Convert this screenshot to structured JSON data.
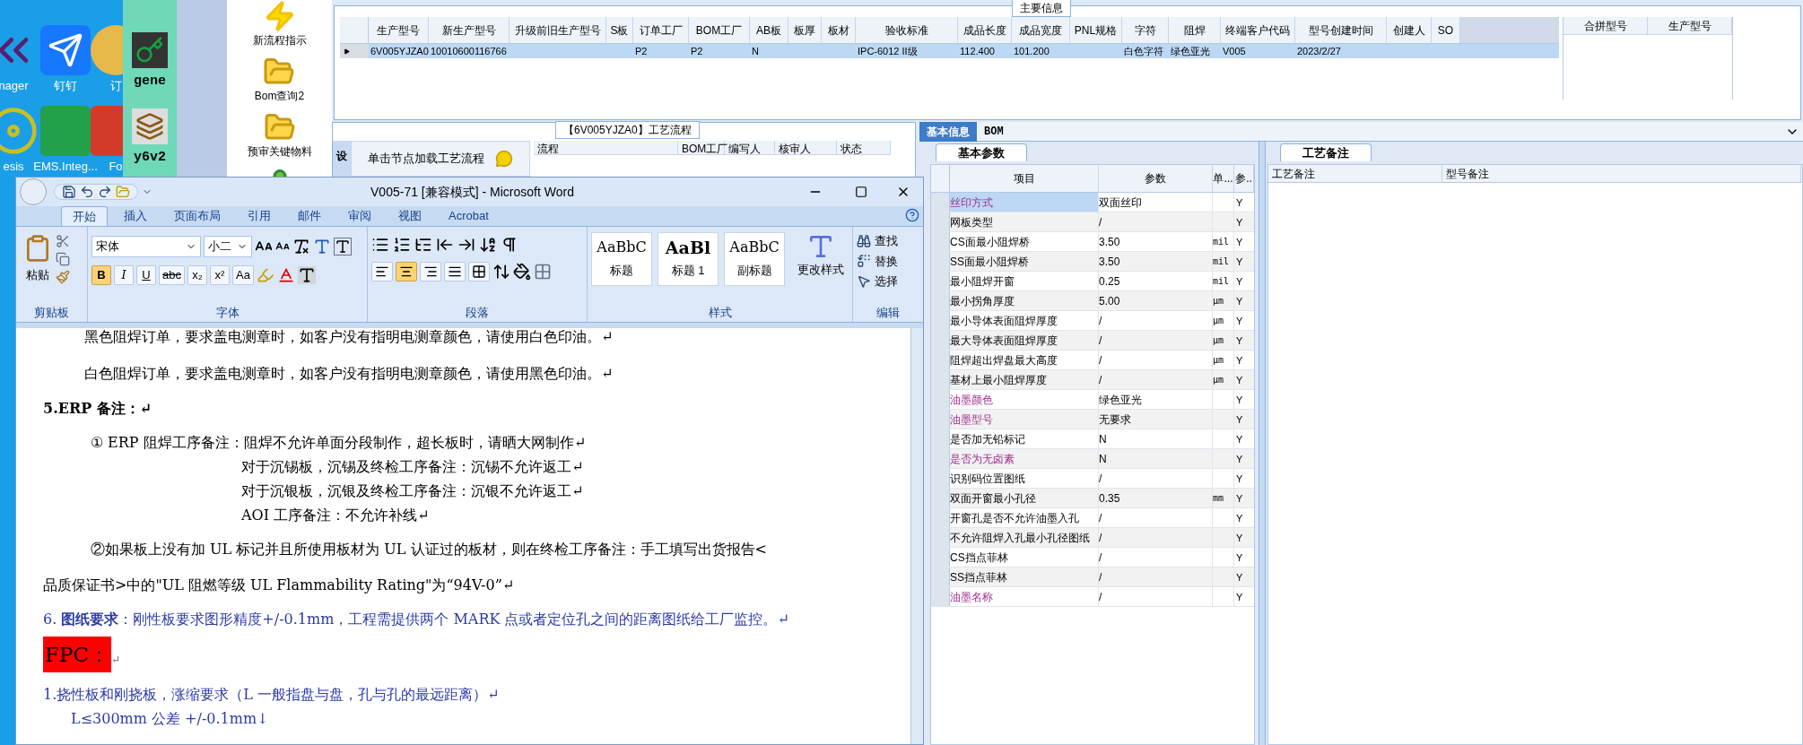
{
  "desktop": {
    "icons": [
      {
        "label": "nager",
        "kind": "k"
      },
      {
        "label": "钉钉",
        "kind": "wing"
      },
      {
        "label": "订",
        "kind": "shell"
      },
      {
        "label": "esis",
        "kind": "disc"
      },
      {
        "label": "EMS.Integ...",
        "kind": "p"
      },
      {
        "label": "Fo",
        "kind": "red"
      }
    ]
  },
  "launcher": {
    "items": [
      {
        "label": "gene",
        "kind": "key"
      },
      {
        "label": "y6v2",
        "kind": "stack"
      }
    ]
  },
  "sidebar": {
    "items": [
      {
        "label": "新流程指示",
        "kind": "bolt"
      },
      {
        "label": "Bom查询2",
        "kind": "folder"
      },
      {
        "label": "预审关键物料",
        "kind": "folder"
      },
      {
        "kind": "person"
      }
    ]
  },
  "main_info": {
    "title": "主要信息",
    "columns": [
      "生产型号",
      "新生产型号",
      "升级前旧生产型号",
      "S板",
      "订单工厂",
      "BOM工厂",
      "AB板",
      "板厚",
      "板材",
      "验收标准",
      "成品长度",
      "成品宽度",
      "PNL规格",
      "字符",
      "阻焊",
      "终端客户代码",
      "型号创建时间",
      "创建人",
      "SO"
    ],
    "rows": [
      {
        "selected": true,
        "cells": [
          "6V005YJZA0",
          "10010600116766",
          null,
          null,
          "P2",
          "P2",
          "N",
          null,
          null,
          "IPC-6012 II级",
          "112.400",
          "101.200",
          null,
          "白色字符",
          "绿色亚光",
          "V005",
          "2023/2/27",
          null,
          null
        ]
      }
    ],
    "merge_table": {
      "columns": [
        "合拼型号",
        "生产型号"
      ]
    }
  },
  "process": {
    "title": "【6V005YJZA0】工艺流程",
    "side_tab": "设",
    "load_button": "单击节点加载工艺流程",
    "tree_columns": [
      "流程",
      "BOM工厂",
      "编写人",
      "核审人",
      "状态"
    ]
  },
  "details": {
    "tabs": [
      {
        "label": "基本信息",
        "selected": true
      },
      {
        "label": "BOM",
        "selected": false
      }
    ],
    "subtab": "基本参数",
    "columns": [
      "项目",
      "参数",
      "单...",
      "参.."
    ],
    "rows": [
      {
        "item": "丝印方式",
        "value": "双面丝印",
        "flag": "Y",
        "required": true,
        "selected": true
      },
      {
        "item": "网板类型",
        "value": "/",
        "flag": "Y",
        "required": false,
        "selected": false
      },
      {
        "item": "CS面最小阻焊桥",
        "value": "3.50",
        "unit": "mil",
        "flag": "Y",
        "required": false,
        "selected": false
      },
      {
        "item": "SS面最小阻焊桥",
        "value": "3.50",
        "unit": "mil",
        "flag": "Y",
        "required": false,
        "selected": false
      },
      {
        "item": "最小阻焊开窗",
        "value": "0.25",
        "unit": "mil",
        "flag": "Y",
        "required": false,
        "selected": false
      },
      {
        "item": "最小拐角厚度",
        "value": "5.00",
        "unit": "μm",
        "flag": "Y",
        "required": false,
        "selected": false
      },
      {
        "item": "最小导体表面阻焊厚度",
        "value": "/",
        "unit": "μm",
        "flag": "Y",
        "required": false,
        "selected": false
      },
      {
        "item": "最大导体表面阻焊厚度",
        "value": "/",
        "unit": "μm",
        "flag": "Y",
        "required": false,
        "selected": false
      },
      {
        "item": "阻焊超出焊盘最大高度",
        "value": "/",
        "unit": "μm",
        "flag": "Y",
        "required": false,
        "selected": false
      },
      {
        "item": "基材上最小阻焊厚度",
        "value": "/",
        "unit": "μm",
        "flag": "Y",
        "required": false,
        "selected": false
      },
      {
        "item": "油墨颜色",
        "value": "绿色亚光",
        "flag": "Y",
        "required": true,
        "selected": false
      },
      {
        "item": "油墨型号",
        "value": "无要求",
        "flag": "Y",
        "required": true,
        "selected": false
      },
      {
        "item": "是否加无铅标记",
        "value": "N",
        "flag": "Y",
        "required": false,
        "selected": false
      },
      {
        "item": "是否为无卤素",
        "value": "N",
        "flag": "Y",
        "required": true,
        "selected": false
      },
      {
        "item": "识别码位置图纸",
        "value": "/",
        "flag": "Y",
        "required": false,
        "selected": false
      },
      {
        "item": "双面开窗最小孔径",
        "value": "0.35",
        "unit": "mm",
        "flag": "Y",
        "required": false,
        "selected": false
      },
      {
        "item": "开窗孔是否不允许油墨入孔",
        "value": "/",
        "flag": "Y",
        "required": false,
        "selected": false
      },
      {
        "item": "不允许阻焊入孔最小孔径图纸",
        "value": "/",
        "flag": "Y",
        "required": false,
        "selected": false
      },
      {
        "item": "CS挡点菲林",
        "value": "/",
        "flag": "Y",
        "required": false,
        "selected": false
      },
      {
        "item": "SS挡点菲林",
        "value": "/",
        "flag": "Y",
        "required": false,
        "selected": false
      },
      {
        "item": "油墨名称",
        "value": "/",
        "flag": "Y",
        "required": true,
        "selected": false
      }
    ],
    "notes": {
      "tab": "工艺备注",
      "columns": [
        "工艺备注",
        "型号备注"
      ]
    }
  },
  "word": {
    "title": "V005-71 [兼容模式] - Microsoft Word",
    "tabs": [
      {
        "label": "开始",
        "selected": true
      },
      {
        "label": "插入",
        "selected": false
      },
      {
        "label": "页面布局",
        "selected": false
      },
      {
        "label": "引用",
        "selected": false
      },
      {
        "label": "邮件",
        "selected": false
      },
      {
        "label": "审阅",
        "selected": false
      },
      {
        "label": "视图",
        "selected": false
      },
      {
        "label": "Acrobat",
        "selected": false
      }
    ],
    "paste": "粘贴",
    "font_name": "宋体",
    "font_size": "小二",
    "format_buttons": [
      {
        "label": "B",
        "on": true
      },
      {
        "label": "I",
        "on": false
      },
      {
        "label": "U",
        "on": false
      },
      {
        "label": "abc",
        "on": false
      },
      {
        "label": "x₂",
        "on": false
      },
      {
        "label": "x²",
        "on": false
      },
      {
        "label": "Aa",
        "on": false
      }
    ],
    "align_buttons": [
      {
        "on": false
      },
      {
        "on": true
      },
      {
        "on": false
      },
      {
        "on": false
      },
      {
        "on": false
      }
    ],
    "styles": [
      {
        "preview": "AaBbC",
        "name": "标题"
      },
      {
        "preview": "AaBl",
        "name": "标题 1"
      },
      {
        "preview": "AaBbC",
        "name": "副标题"
      }
    ],
    "change_styles": "更改样式",
    "editing": [
      "查找",
      "替换",
      "选择"
    ],
    "groups": [
      "剪贴板",
      "字体",
      "段落",
      "样式",
      "编辑"
    ],
    "paragraphs": [
      {
        "kind": "body",
        "text": "黑色阻焊订单，要求盖电测章时，如客户没有指明电测章颜色，请使用白色印油。↵"
      },
      {
        "kind": "body",
        "text": "白色阻焊订单，要求盖电测章时，如客户没有指明电测章颜色，请使用黑色印油。↵"
      },
      {
        "kind": "heading",
        "text": "5.ERP 备注：↵"
      },
      {
        "kind": "item",
        "text": "① ERP 阻焊工序备注：阻焊不允许单面分段制作，超长板时，请晒大网制作↵"
      },
      {
        "kind": "sub",
        "text": "对于沉锡板，沉锡及终检工序备注：沉锡不允许返工↵"
      },
      {
        "kind": "sub",
        "text": "对于沉银板，沉银及终检工序备注：沉银不允许返工↵"
      },
      {
        "kind": "sub",
        "text": "AOI 工序备注：不允许补线↵"
      },
      {
        "kind": "item",
        "text": "②如果板上没有加 UL 标记并且所使用板材为 UL 认证过的板材，则在终检工序备注：手工填写出货报告<"
      },
      {
        "kind": "plain",
        "text": "品质保证书>中的\"UL 阻燃等级 UL Flammability Rating\"为“94V-0”↵"
      },
      {
        "kind": "blue",
        "text": "6. **图纸要求**：刚性板要求图形精度+/-0.1mm，工程需提供两个 MARK 点或者定位孔之间的距离图纸给工厂监控。↵"
      },
      {
        "kind": "fpc",
        "text": "FPC：",
        "end": "↵"
      },
      {
        "kind": "blue",
        "text": "1.挠性板和刚挠板，涨缩要求（L 一般指盘与盘，孔与孔的最远距离）↵"
      },
      {
        "kind": "blue_indent",
        "text": "L≤300mm 公差 +/-0.1mm↓"
      }
    ]
  }
}
